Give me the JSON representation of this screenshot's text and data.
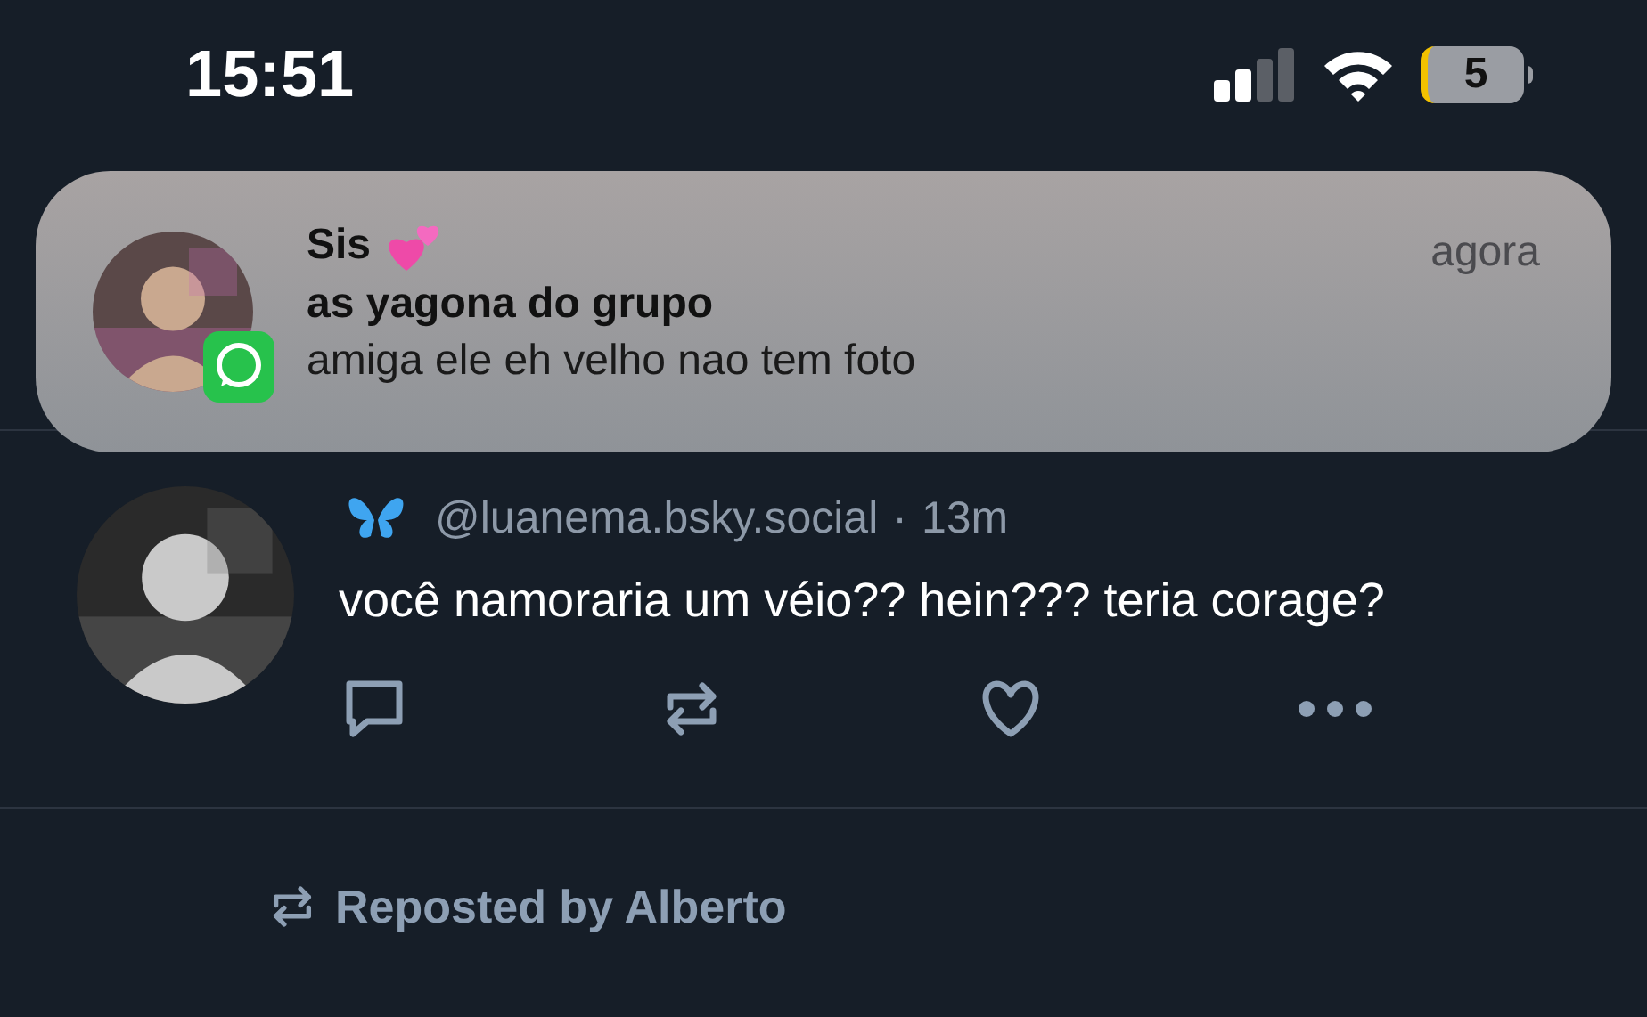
{
  "status_bar": {
    "time": "15:51",
    "battery": "5"
  },
  "notification": {
    "title": "Sis",
    "group": "as yagona do grupo",
    "message": "amiga ele eh velho nao tem foto",
    "time": "agora"
  },
  "post": {
    "handle": "@luanema.bsky.social",
    "separator": "·",
    "age": "13m",
    "text": "você namoraria um véio?? hein??? teria corage?"
  },
  "next_post": {
    "repost_label": "Reposted by Alberto"
  }
}
